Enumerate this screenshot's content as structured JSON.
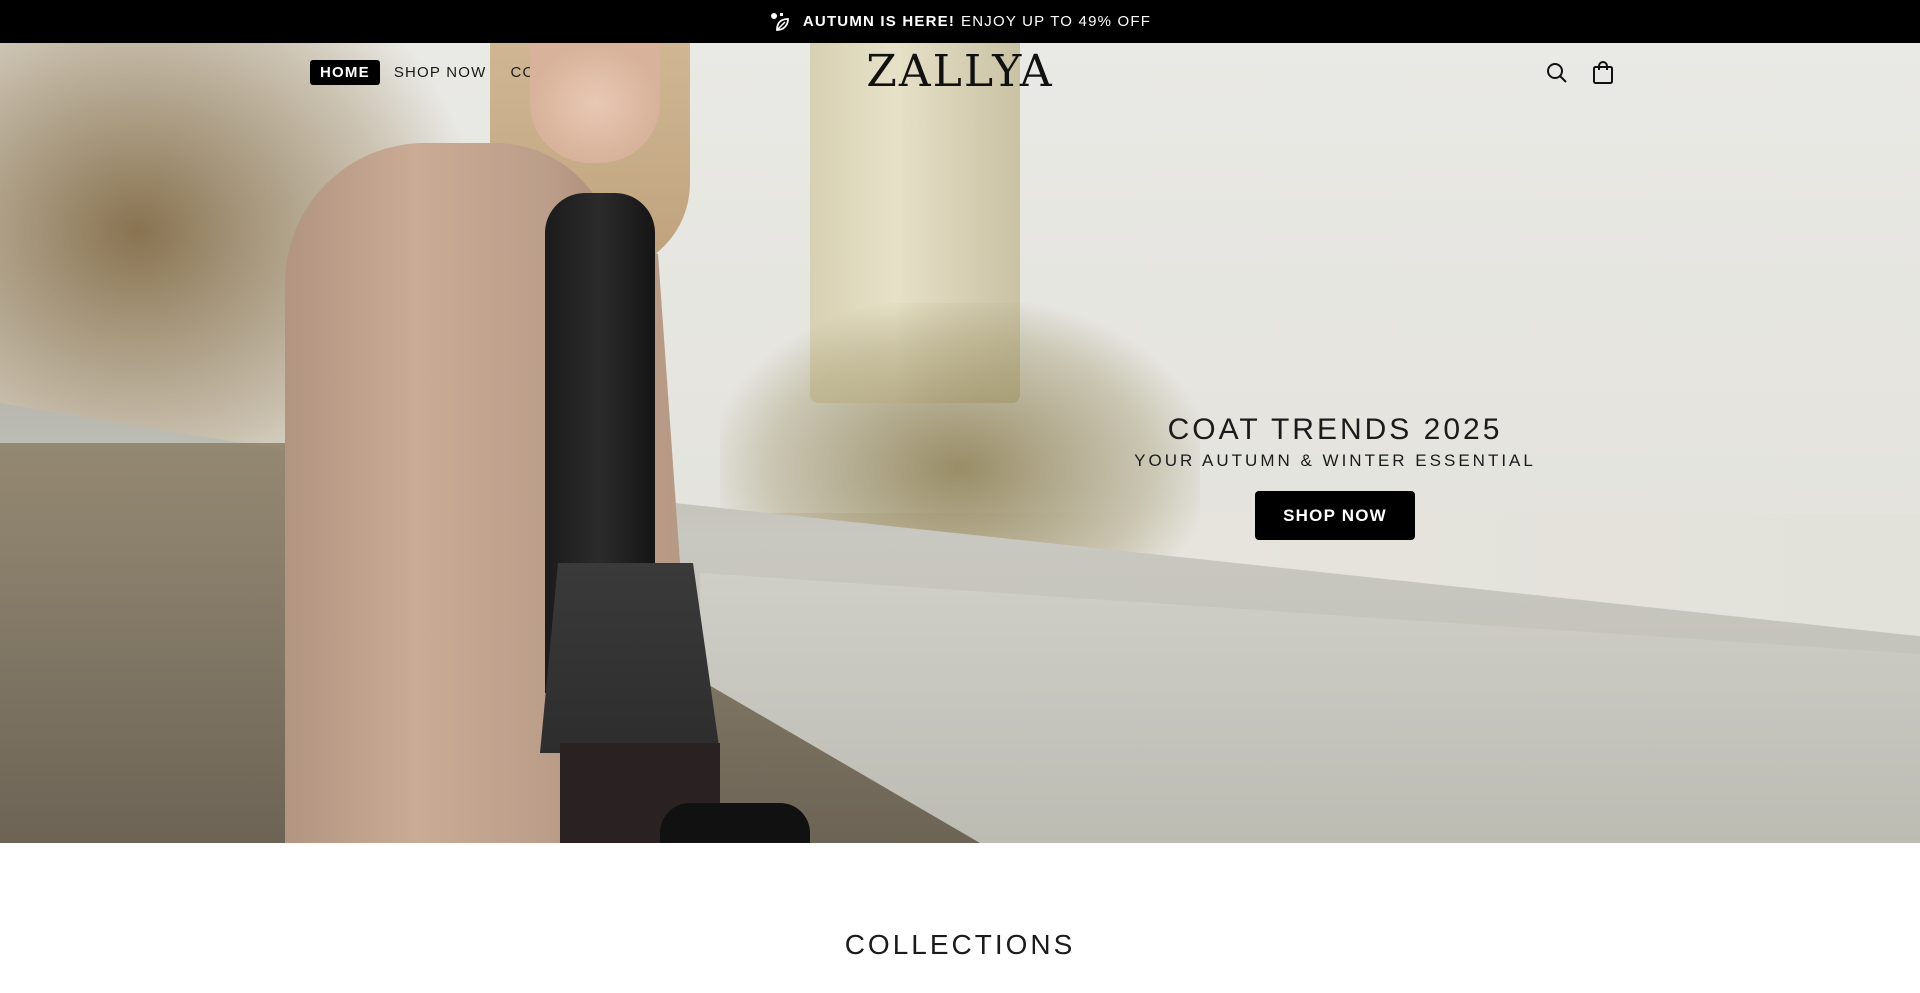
{
  "announcement": {
    "icon": "leaf-icon",
    "highlight": "AUTUMN IS HERE!",
    "text": "ENJOY UP TO 49% OFF"
  },
  "header": {
    "nav": [
      {
        "label": "HOME",
        "active": true
      },
      {
        "label": "SHOP NOW",
        "active": false
      },
      {
        "label": "CONTACT",
        "active": false
      }
    ],
    "logo": "ZALLYA",
    "icons": [
      "search-icon",
      "shopping-bag-icon"
    ]
  },
  "hero": {
    "title": "COAT TRENDS 2025",
    "subtitle": "YOUR AUTUMN & WINTER ESSENTIAL",
    "button_label": "SHOP NOW"
  },
  "collections": {
    "title": "COLLECTIONS"
  },
  "colors": {
    "announcement_bg": "#000000",
    "button_bg": "#000000",
    "button_text": "#ffffff"
  }
}
